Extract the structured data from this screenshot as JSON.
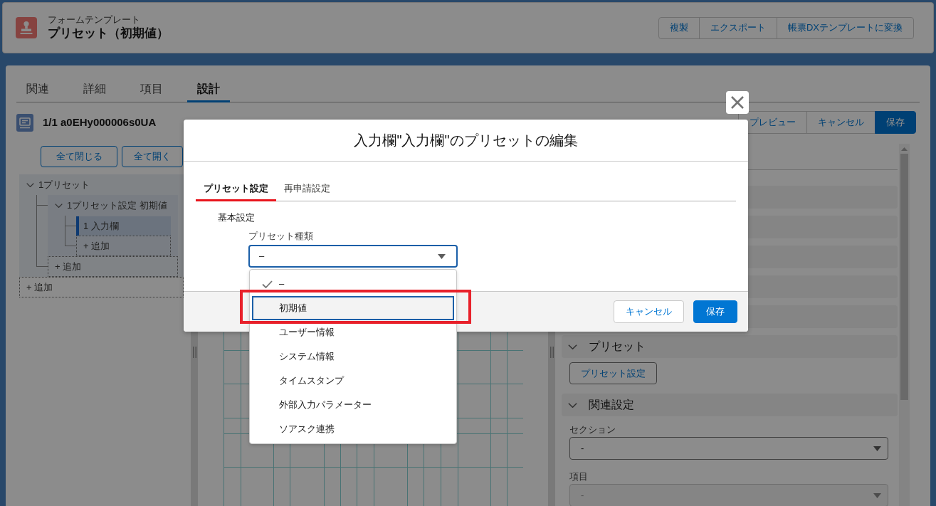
{
  "header": {
    "object_label": "フォームテンプレート",
    "title": "プリセット（初期値）",
    "actions": [
      "複製",
      "エクスポート",
      "帳票DXテンプレートに変換"
    ]
  },
  "tabs": [
    {
      "label": "関連",
      "selected": false
    },
    {
      "label": "詳細",
      "selected": false
    },
    {
      "label": "項目",
      "selected": false
    },
    {
      "label": "設計",
      "selected": true
    }
  ],
  "record": {
    "title": "1/1 a0EHy000006s0UA"
  },
  "tree_actions": [
    "全て閉じる",
    "全て開く"
  ],
  "tree": [
    {
      "kind": "node",
      "label": "1プリセット",
      "expanded": true,
      "selected": false,
      "children": [
        {
          "kind": "node",
          "label": "1プリセット設定 初期値",
          "expanded": true,
          "selected": false,
          "children": [
            {
              "kind": "node",
              "label": "1 入力欄",
              "selected": true
            },
            {
              "kind": "add",
              "label": "+ 追加"
            }
          ]
        },
        {
          "kind": "add",
          "label": "+ 追加"
        }
      ]
    },
    {
      "kind": "add",
      "label": "+ 追加"
    }
  ],
  "designer_toolbar": [
    {
      "label": "プレビュー",
      "kind": "neutral"
    },
    {
      "label": "キャンセル",
      "kind": "neutral"
    },
    {
      "label": "保存",
      "kind": "brand"
    }
  ],
  "property_panel": {
    "sections": [
      {
        "kind": "covered"
      },
      {
        "kind": "covered"
      },
      {
        "kind": "covered"
      },
      {
        "kind": "covered"
      },
      {
        "kind": "covered"
      },
      {
        "kind": "buttons",
        "label": "プリセット",
        "expanded": true,
        "buttons": [
          "プリセット設定"
        ]
      },
      {
        "kind": "fields",
        "label": "関連設定",
        "expanded": true,
        "fields": [
          {
            "label": "セクション",
            "value": "-",
            "disabled": false
          },
          {
            "label": "項目",
            "value": "-",
            "disabled": true
          }
        ]
      }
    ]
  },
  "modal": {
    "title": "入力欄\"入力欄\"のプリセットの編集",
    "tabs": [
      {
        "label": "プリセット設定",
        "selected": true
      },
      {
        "label": "再申請設定",
        "selected": false
      }
    ],
    "section_title": "基本設定",
    "field": {
      "label": "プリセット種類",
      "value": "–",
      "expanded": true,
      "options": [
        {
          "label": "–",
          "selected": true,
          "focused": false,
          "annotated": false
        },
        {
          "label": "初期値",
          "selected": false,
          "focused": true,
          "annotated": true
        },
        {
          "label": "ユーザー情報",
          "selected": false,
          "focused": false,
          "annotated": false
        },
        {
          "label": "システム情報",
          "selected": false,
          "focused": false,
          "annotated": false
        },
        {
          "label": "タイムスタンプ",
          "selected": false,
          "focused": false,
          "annotated": false
        },
        {
          "label": "外部入力パラメーター",
          "selected": false,
          "focused": false,
          "annotated": false
        },
        {
          "label": "ソアスク連携",
          "selected": false,
          "focused": false,
          "annotated": false
        }
      ]
    },
    "buttons": [
      {
        "label": "キャンセル",
        "kind": "neutral"
      },
      {
        "label": "保存",
        "kind": "brand"
      }
    ]
  }
}
